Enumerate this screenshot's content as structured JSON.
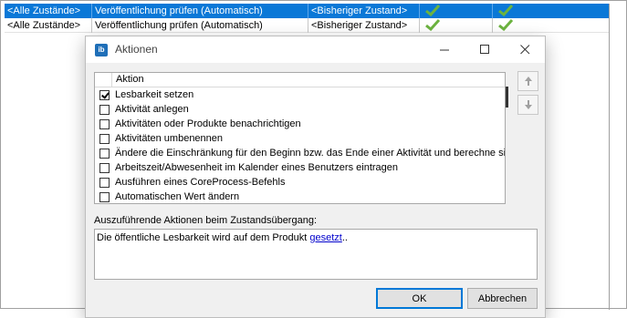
{
  "background": {
    "rows": [
      {
        "state_from": "<Alle Zustände>",
        "check": "Veröffentlichung prüfen (Automatisch)",
        "state_to": "<Bisheriger Zustand>",
        "selected": true
      },
      {
        "state_from": "<Alle Zustände>",
        "check": "Veröffentlichung prüfen (Automatisch)",
        "state_to": "<Bisheriger Zustand>",
        "selected": false
      }
    ]
  },
  "dialog": {
    "app_icon": "ib",
    "title": "Aktionen",
    "list_header": "Aktion",
    "items": [
      {
        "label": "Lesbarkeit setzen",
        "checked": true
      },
      {
        "label": "Aktivität anlegen",
        "checked": false
      },
      {
        "label": "Aktivitäten oder Produkte benachrichtigen",
        "checked": false
      },
      {
        "label": "Aktivitäten umbenennen",
        "checked": false
      },
      {
        "label": "Ändere die Einschränkung für den Beginn bzw. das Ende einer Aktivität und berechne si",
        "checked": false
      },
      {
        "label": "Arbeitszeit/Abwesenheit im Kalender eines Benutzers eintragen",
        "checked": false
      },
      {
        "label": "Ausführen eines CoreProcess-Befehls",
        "checked": false
      },
      {
        "label": "Automatischen Wert ändern",
        "checked": false
      }
    ],
    "description_label": "Auszuführende Aktionen beim Zustandsübergang:",
    "description": {
      "prefix": "Die öffentliche Lesbarkeit wird auf dem Produkt ",
      "link": "gesetzt",
      "suffix": ".."
    },
    "ok_label": "OK",
    "cancel_label": "Abbrechen"
  },
  "icons": {
    "check": "green-check-icon",
    "up": "arrow-up-icon",
    "down": "arrow-down-icon",
    "minimize": "minimize-icon",
    "maximize": "maximize-icon",
    "close": "close-icon"
  },
  "colors": {
    "selection": "#0a78d7",
    "check_green": "#6cb33f",
    "link": "#0000cc",
    "default_button_border": "#0078d7"
  }
}
